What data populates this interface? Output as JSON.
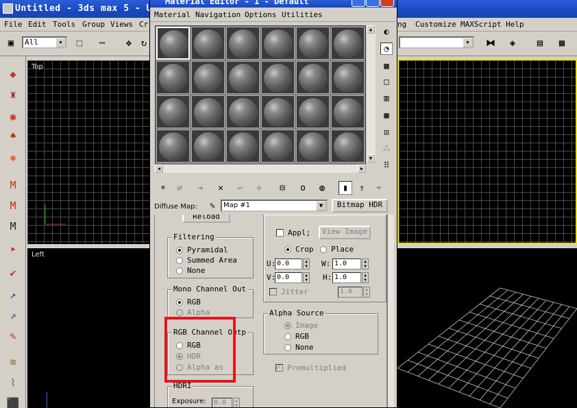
{
  "app": {
    "title": "Untitled - 3ds max 5 - U",
    "menus": [
      "File",
      "Edit",
      "Tools",
      "Group",
      "Views",
      "Cr",
      "ng",
      "Customize",
      "MAXScript",
      "Help"
    ],
    "selection_filter": "All"
  },
  "viewports": {
    "top_label": "Top",
    "left_label": "Left"
  },
  "material_editor": {
    "title": "Material Editor - 1 - Default",
    "menus": [
      "Material",
      "Navigation",
      "Options",
      "Utilities"
    ],
    "diffuse_label": "Diffuse Map:",
    "map_name": "Map #1",
    "bitmap_button": "Bitmap HDR",
    "reload_button": "Reload",
    "filtering": {
      "title": "Filtering",
      "options": [
        "Pyramidal",
        "Summed Area",
        "None"
      ],
      "selected": "Pyramidal"
    },
    "mono_channel": {
      "title": "Mono Channel Out",
      "options": [
        "RGB",
        "Alpha"
      ],
      "selected": "RGB"
    },
    "rgb_channel": {
      "title": "RGB Channel Outp",
      "options": [
        "RGB",
        "HDR",
        "Alpha as"
      ],
      "selected": "HDR"
    },
    "hdri": {
      "title": "HDRI",
      "exposure_label": "Exposure:",
      "exposure_value": "0.0"
    },
    "cropping": {
      "apply_label": "Appl;",
      "view_image_button": "View Image",
      "crop_label": "Crop",
      "place_label": "Place",
      "selected": "Crop",
      "u_label": "U:",
      "u_value": "0.0",
      "v_label": "V:",
      "v_value": "0.0",
      "w_label": "W:",
      "w_value": "1.0",
      "h_label": "H:",
      "h_value": "1.0",
      "jitter_label": "Jitter",
      "jitter_value": "1.0"
    },
    "alpha_source": {
      "title": "Alpha Source",
      "options": [
        "Image",
        "RGB",
        "None"
      ],
      "selected": "Image"
    },
    "premultiplied_label": "Premultiplied"
  }
}
